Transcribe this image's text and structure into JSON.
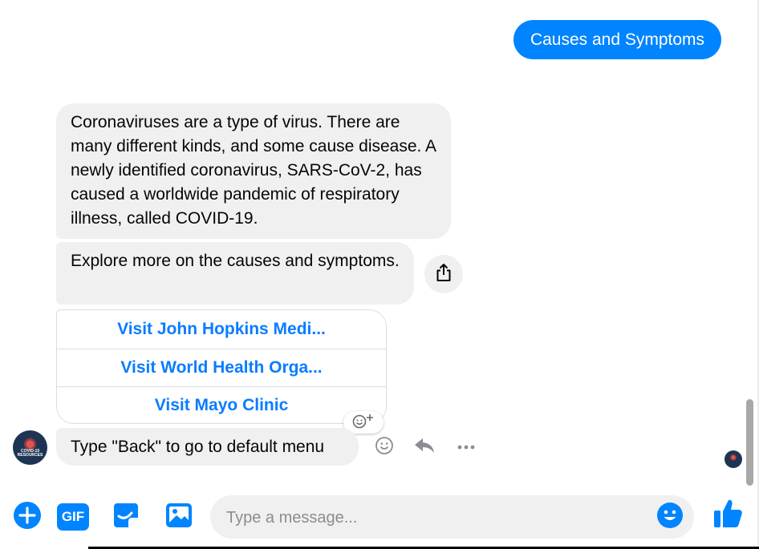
{
  "messages": {
    "outgoing_text": "Causes and Symptoms",
    "incoming_1": "Coronaviruses are a type of virus. There are many different kinds, and some cause disease. A newly identified coronavirus, SARS-CoV-2, has caused a worldwide pandemic of respiratory illness, called COVID-19.",
    "incoming_2": "Explore more on the causes and symptoms.",
    "buttons": [
      {
        "label": "Visit John Hopkins Medi..."
      },
      {
        "label": "Visit World Health Orga..."
      },
      {
        "label": "Visit Mayo Clinic"
      }
    ],
    "incoming_3": "Type \"Back\" to go to default menu"
  },
  "avatar": {
    "label_line1": "COVID-19",
    "label_line2": "RESOURCES"
  },
  "composer": {
    "placeholder": "Type a message...",
    "gif_label": "GIF"
  },
  "icons": {
    "share": "share-icon",
    "add_reaction": "add-reaction-icon",
    "emoji": "emoji-icon",
    "reply": "reply-icon",
    "more": "more-icon",
    "add": "plus-icon",
    "gif": "gif-icon",
    "sticker": "sticker-icon",
    "image": "image-icon",
    "thumbs_up": "thumbs-up-icon"
  },
  "colors": {
    "accent": "#0084ff",
    "link": "#0a7cff",
    "bubble_gray": "#f0f0f0"
  }
}
